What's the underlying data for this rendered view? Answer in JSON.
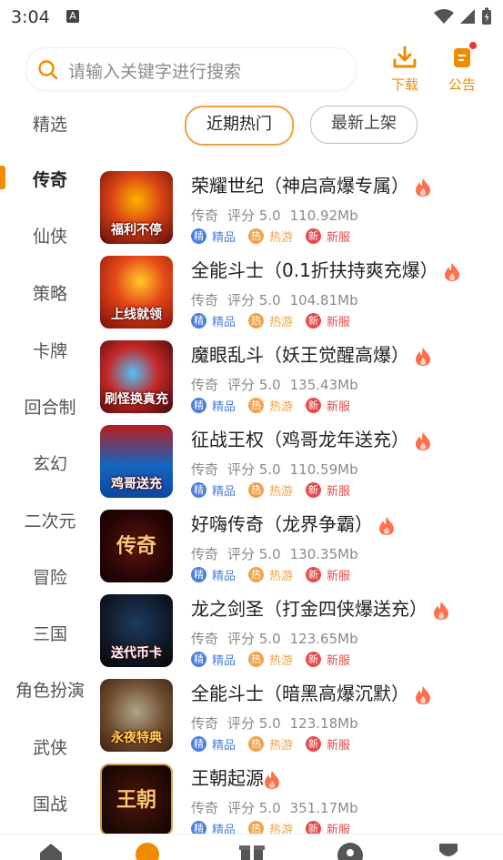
{
  "status": {
    "time": "3:04",
    "a_badge": "A"
  },
  "header": {
    "search_placeholder": "请输入关键字进行搜索",
    "download_label": "下载",
    "notice_label": "公告",
    "accent": "#f08a00"
  },
  "sidebar": {
    "selected": "精选",
    "items": [
      "传奇",
      "仙侠",
      "策略",
      "卡牌",
      "回合制",
      "玄幻",
      "二次元",
      "冒险",
      "三国",
      "角色扮演",
      "武侠",
      "国战"
    ]
  },
  "tabs": [
    {
      "label": "近期热门",
      "active": true
    },
    {
      "label": "最新上架",
      "active": false
    }
  ],
  "tag_labels": {
    "jing_dot": "精",
    "jing": "精品",
    "re_dot": "热",
    "re": "热游",
    "xin_dot": "新",
    "xin": "新服"
  },
  "games": [
    {
      "title": "荣耀世纪（神启高爆专属）",
      "genre": "传奇",
      "rating": "评分 5.0",
      "size": "110.92Mb",
      "thumb_caption": "福利不停"
    },
    {
      "title": "全能斗士（0.1折扶持爽充爆）",
      "genre": "传奇",
      "rating": "评分 5.0",
      "size": "104.81Mb",
      "thumb_caption": "上线就领"
    },
    {
      "title": "魔眼乱斗（妖王觉醒高爆）",
      "genre": "传奇",
      "rating": "评分 5.0",
      "size": "135.43Mb",
      "thumb_caption": "刷怪换真充"
    },
    {
      "title": "征战王权（鸡哥龙年送充）",
      "genre": "传奇",
      "rating": "评分 5.0",
      "size": "110.59Mb",
      "thumb_caption": "鸡哥送充"
    },
    {
      "title": "好嗨传奇（龙界争霸）",
      "genre": "传奇",
      "rating": "评分 5.0",
      "size": "130.35Mb",
      "thumb_caption": "传奇"
    },
    {
      "title": "龙之剑圣（打金四侠爆送充）",
      "genre": "传奇",
      "rating": "评分 5.0",
      "size": "123.65Mb",
      "thumb_caption": "送代币卡"
    },
    {
      "title": "全能斗士（暗黑高爆沉默）",
      "genre": "传奇",
      "rating": "评分 5.0",
      "size": "123.18Mb",
      "thumb_caption": "永夜特典"
    },
    {
      "title": "王朝起源",
      "genre": "传奇",
      "rating": "评分 5.0",
      "size": "351.17Mb",
      "thumb_caption": "王朝"
    }
  ]
}
